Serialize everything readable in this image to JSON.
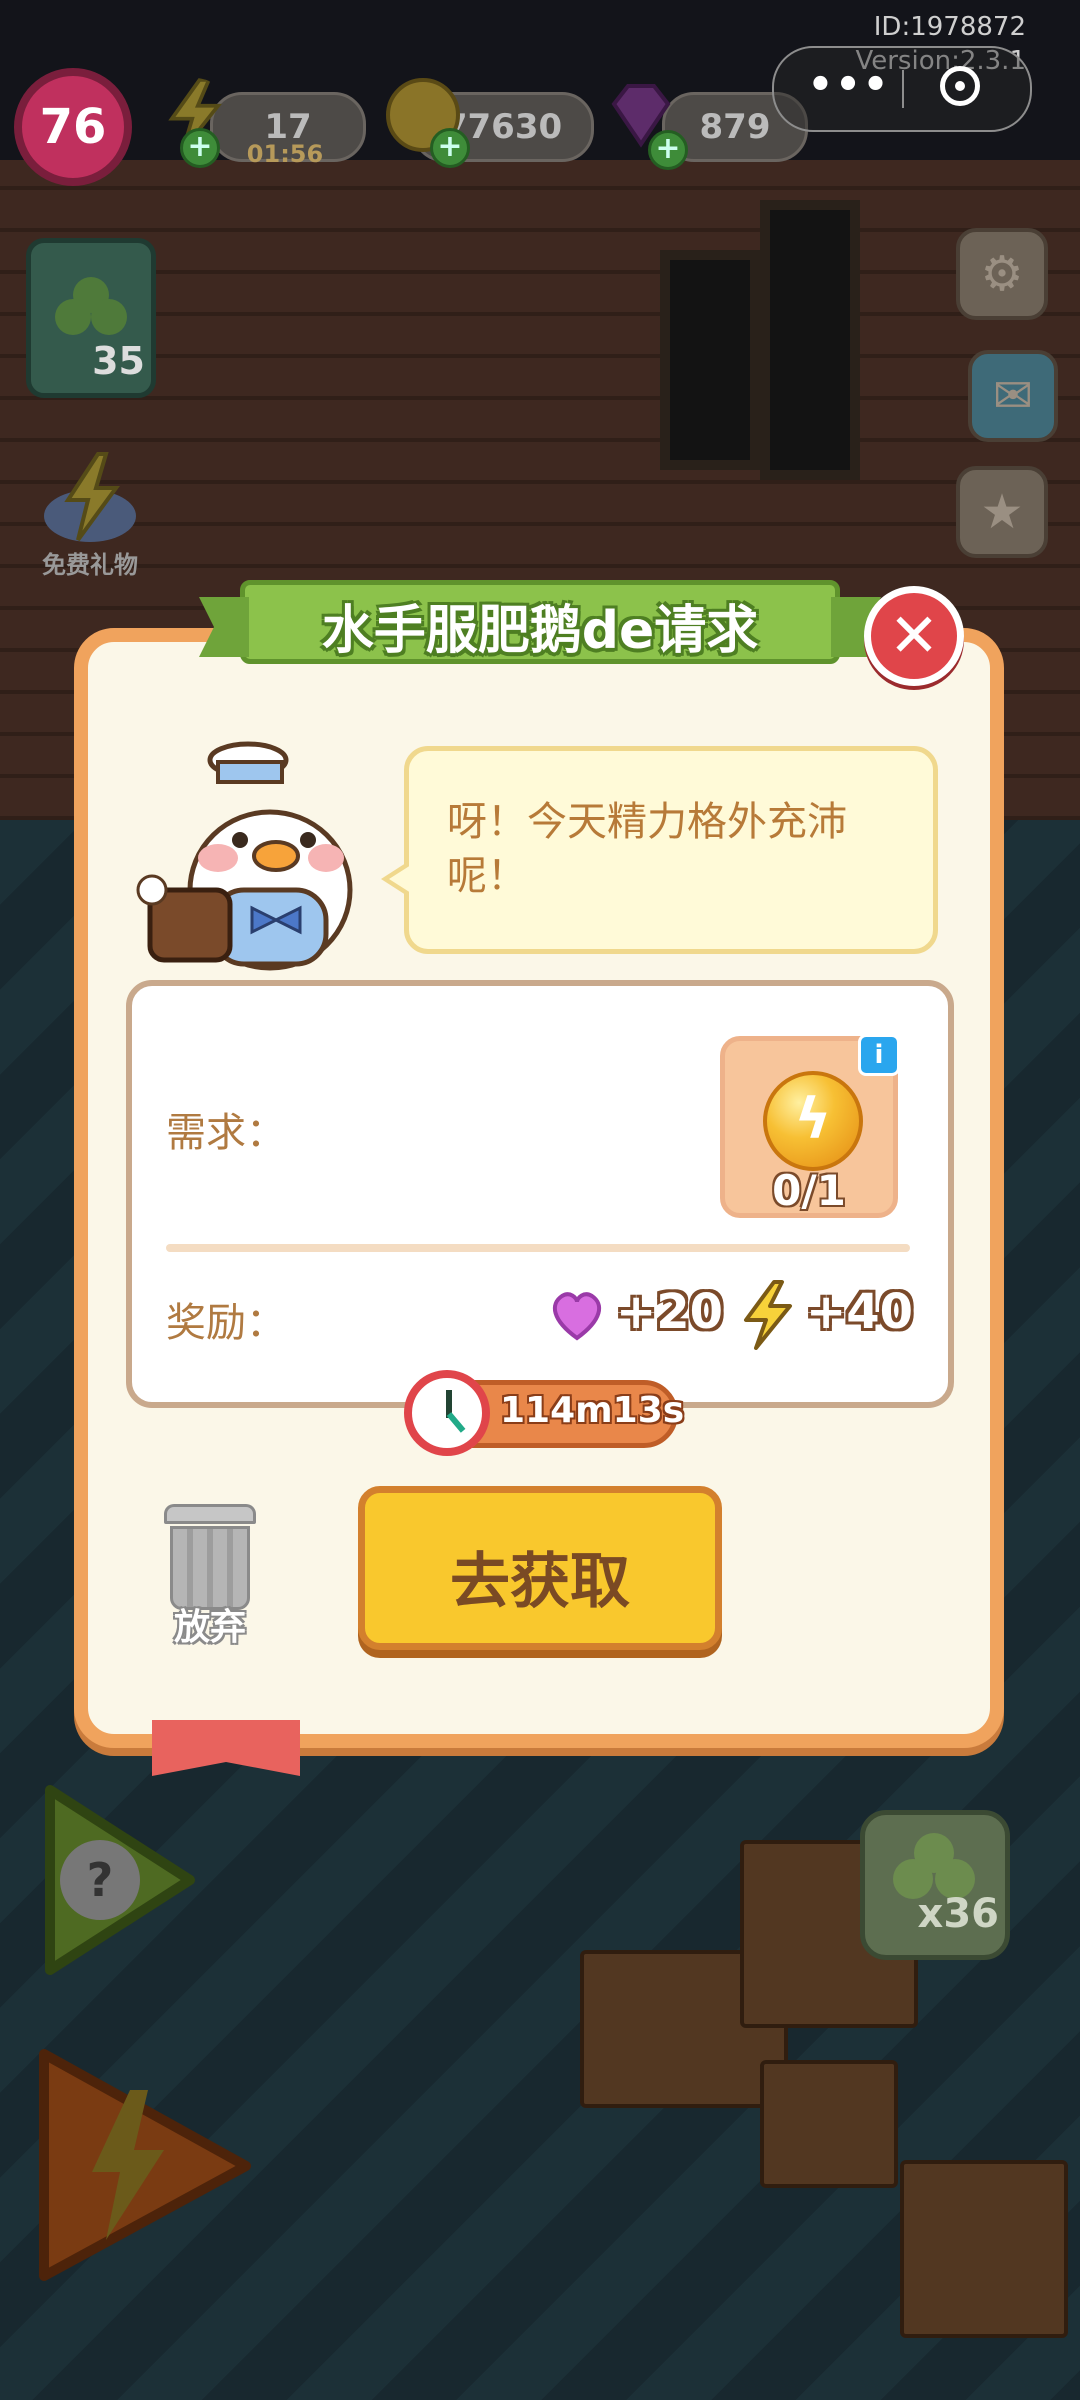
{
  "hud": {
    "level": "76",
    "energy": "17",
    "energy_timer": "01:56",
    "coins": "77630",
    "gems": "879",
    "id_text": "ID:1978872",
    "version_text": "Version:2.3.1",
    "capsule_dots": "•••"
  },
  "left_panel": {
    "card_count": "35",
    "free_gift_label": "免费礼物"
  },
  "bag": {
    "count": "x36"
  },
  "modal": {
    "title": "水手服肥鹅de请求",
    "close_symbol": "✕",
    "dialogue": "呀！今天精力格外充沛呢！",
    "requirement_label": "需求：",
    "requirement_progress": "0/1",
    "info_symbol": "i",
    "reward_label": "奖励：",
    "reward_hearts": "+20",
    "reward_energy": "+40",
    "timer": "114m13s",
    "abandon_label": "放弃",
    "go_button": "去获取"
  },
  "colors": {
    "modal_border": "#f0a35d",
    "title_green": "#8cc24b",
    "close_red": "#e0454a",
    "go_yellow": "#f9c82d",
    "label_brown": "#b07a41"
  },
  "icons": {
    "settings": "gear-icon",
    "mail": "mail-icon",
    "trophy": "trophy-icon",
    "help": "question-icon",
    "energy": "lightning-icon",
    "heart": "heart-icon",
    "clock": "clock-icon",
    "trash": "trash-icon"
  }
}
